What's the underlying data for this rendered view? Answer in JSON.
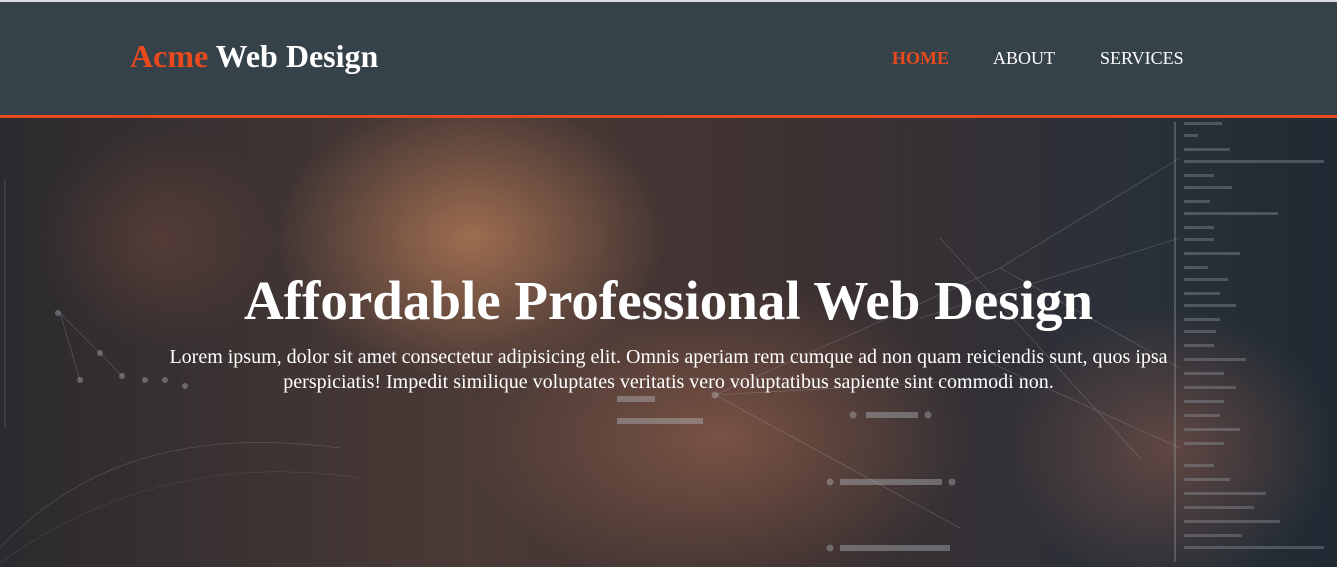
{
  "brand": {
    "accent_text": "Acme",
    "rest_text": "Web Design"
  },
  "nav": {
    "items": [
      {
        "label": "HOME",
        "active": true
      },
      {
        "label": "ABOUT",
        "active": false
      },
      {
        "label": "SERVICES",
        "active": false
      }
    ]
  },
  "hero": {
    "title": "Affordable Professional Web Design",
    "text": "Lorem ipsum, dolor sit amet consectetur adipisicing elit. Omnis aperiam rem cumque ad non quam reiciendis sunt, quos ipsa perspiciatis! Impedit similique voluptates veritatis vero voluptatibus sapiente sint commodi non."
  },
  "colors": {
    "header_bg": "#35424a",
    "accent": "#e8491d",
    "text": "#ffffff"
  }
}
